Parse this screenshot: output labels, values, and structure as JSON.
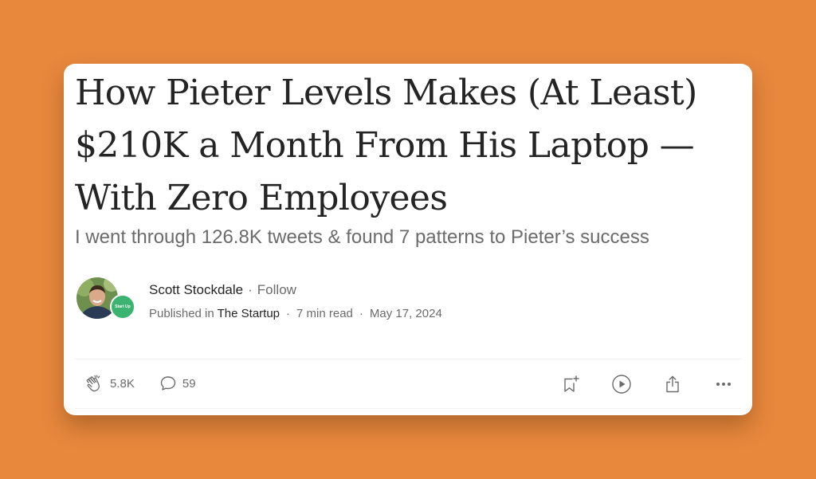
{
  "article": {
    "title_lines": [
      "How Pieter Levels Makes (At Least)",
      "$210K a Month From His Laptop —",
      "With Zero Employees"
    ],
    "subtitle": "I went through 126.8K tweets & found 7 patterns to Pieter’s success"
  },
  "author": {
    "name": "Scott Stockdale",
    "separator": "·",
    "follow_label": "Follow",
    "publication_badge_text": "Start Up"
  },
  "meta": {
    "published_in_label": "Published in",
    "publication": "The Startup",
    "separator": "·",
    "read_time": "7 min read",
    "date": "May 17, 2024"
  },
  "actions": {
    "claps": "5.8K",
    "responses": "59",
    "icons": [
      "clap-icon",
      "comment-icon",
      "bookmark-add-icon",
      "play-icon",
      "share-icon",
      "more-icon"
    ]
  },
  "colors": {
    "background": "#E8883D",
    "card": "#FFFFFF",
    "text_primary": "#242424",
    "text_secondary": "#6B6B6B",
    "publication_badge": "#3CB371"
  }
}
